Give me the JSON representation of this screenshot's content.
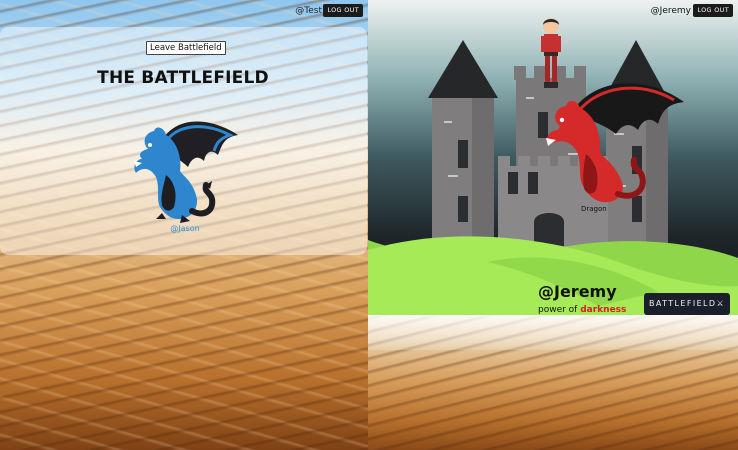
{
  "left_pane": {
    "user_handle": "@Test",
    "logout_label": "LOG OUT",
    "leave_button_label": "Leave Battlefield",
    "title": "THE BATTLEFIELD",
    "opponent_handle": "@Jason"
  },
  "right_pane": {
    "user_handle": "@Jeremy",
    "logout_label": "LOG OUT",
    "dragon_label": "Dragon",
    "player_name": "@Jeremy",
    "power_prefix": "power of ",
    "power_word": "darkness",
    "battlefield_button_label": "BATTLEFIELD⚔"
  },
  "colors": {
    "blue_dragon": "#2e86cf",
    "red_dragon": "#d42a2a",
    "grass": "#9be24f",
    "castle": "#7d7a7c",
    "button_dark": "#1b1f2b"
  },
  "icons": [
    "blue-dragon-illustration",
    "red-dragon-illustration",
    "knight-avatar",
    "castle-illustration",
    "swords-icon"
  ]
}
